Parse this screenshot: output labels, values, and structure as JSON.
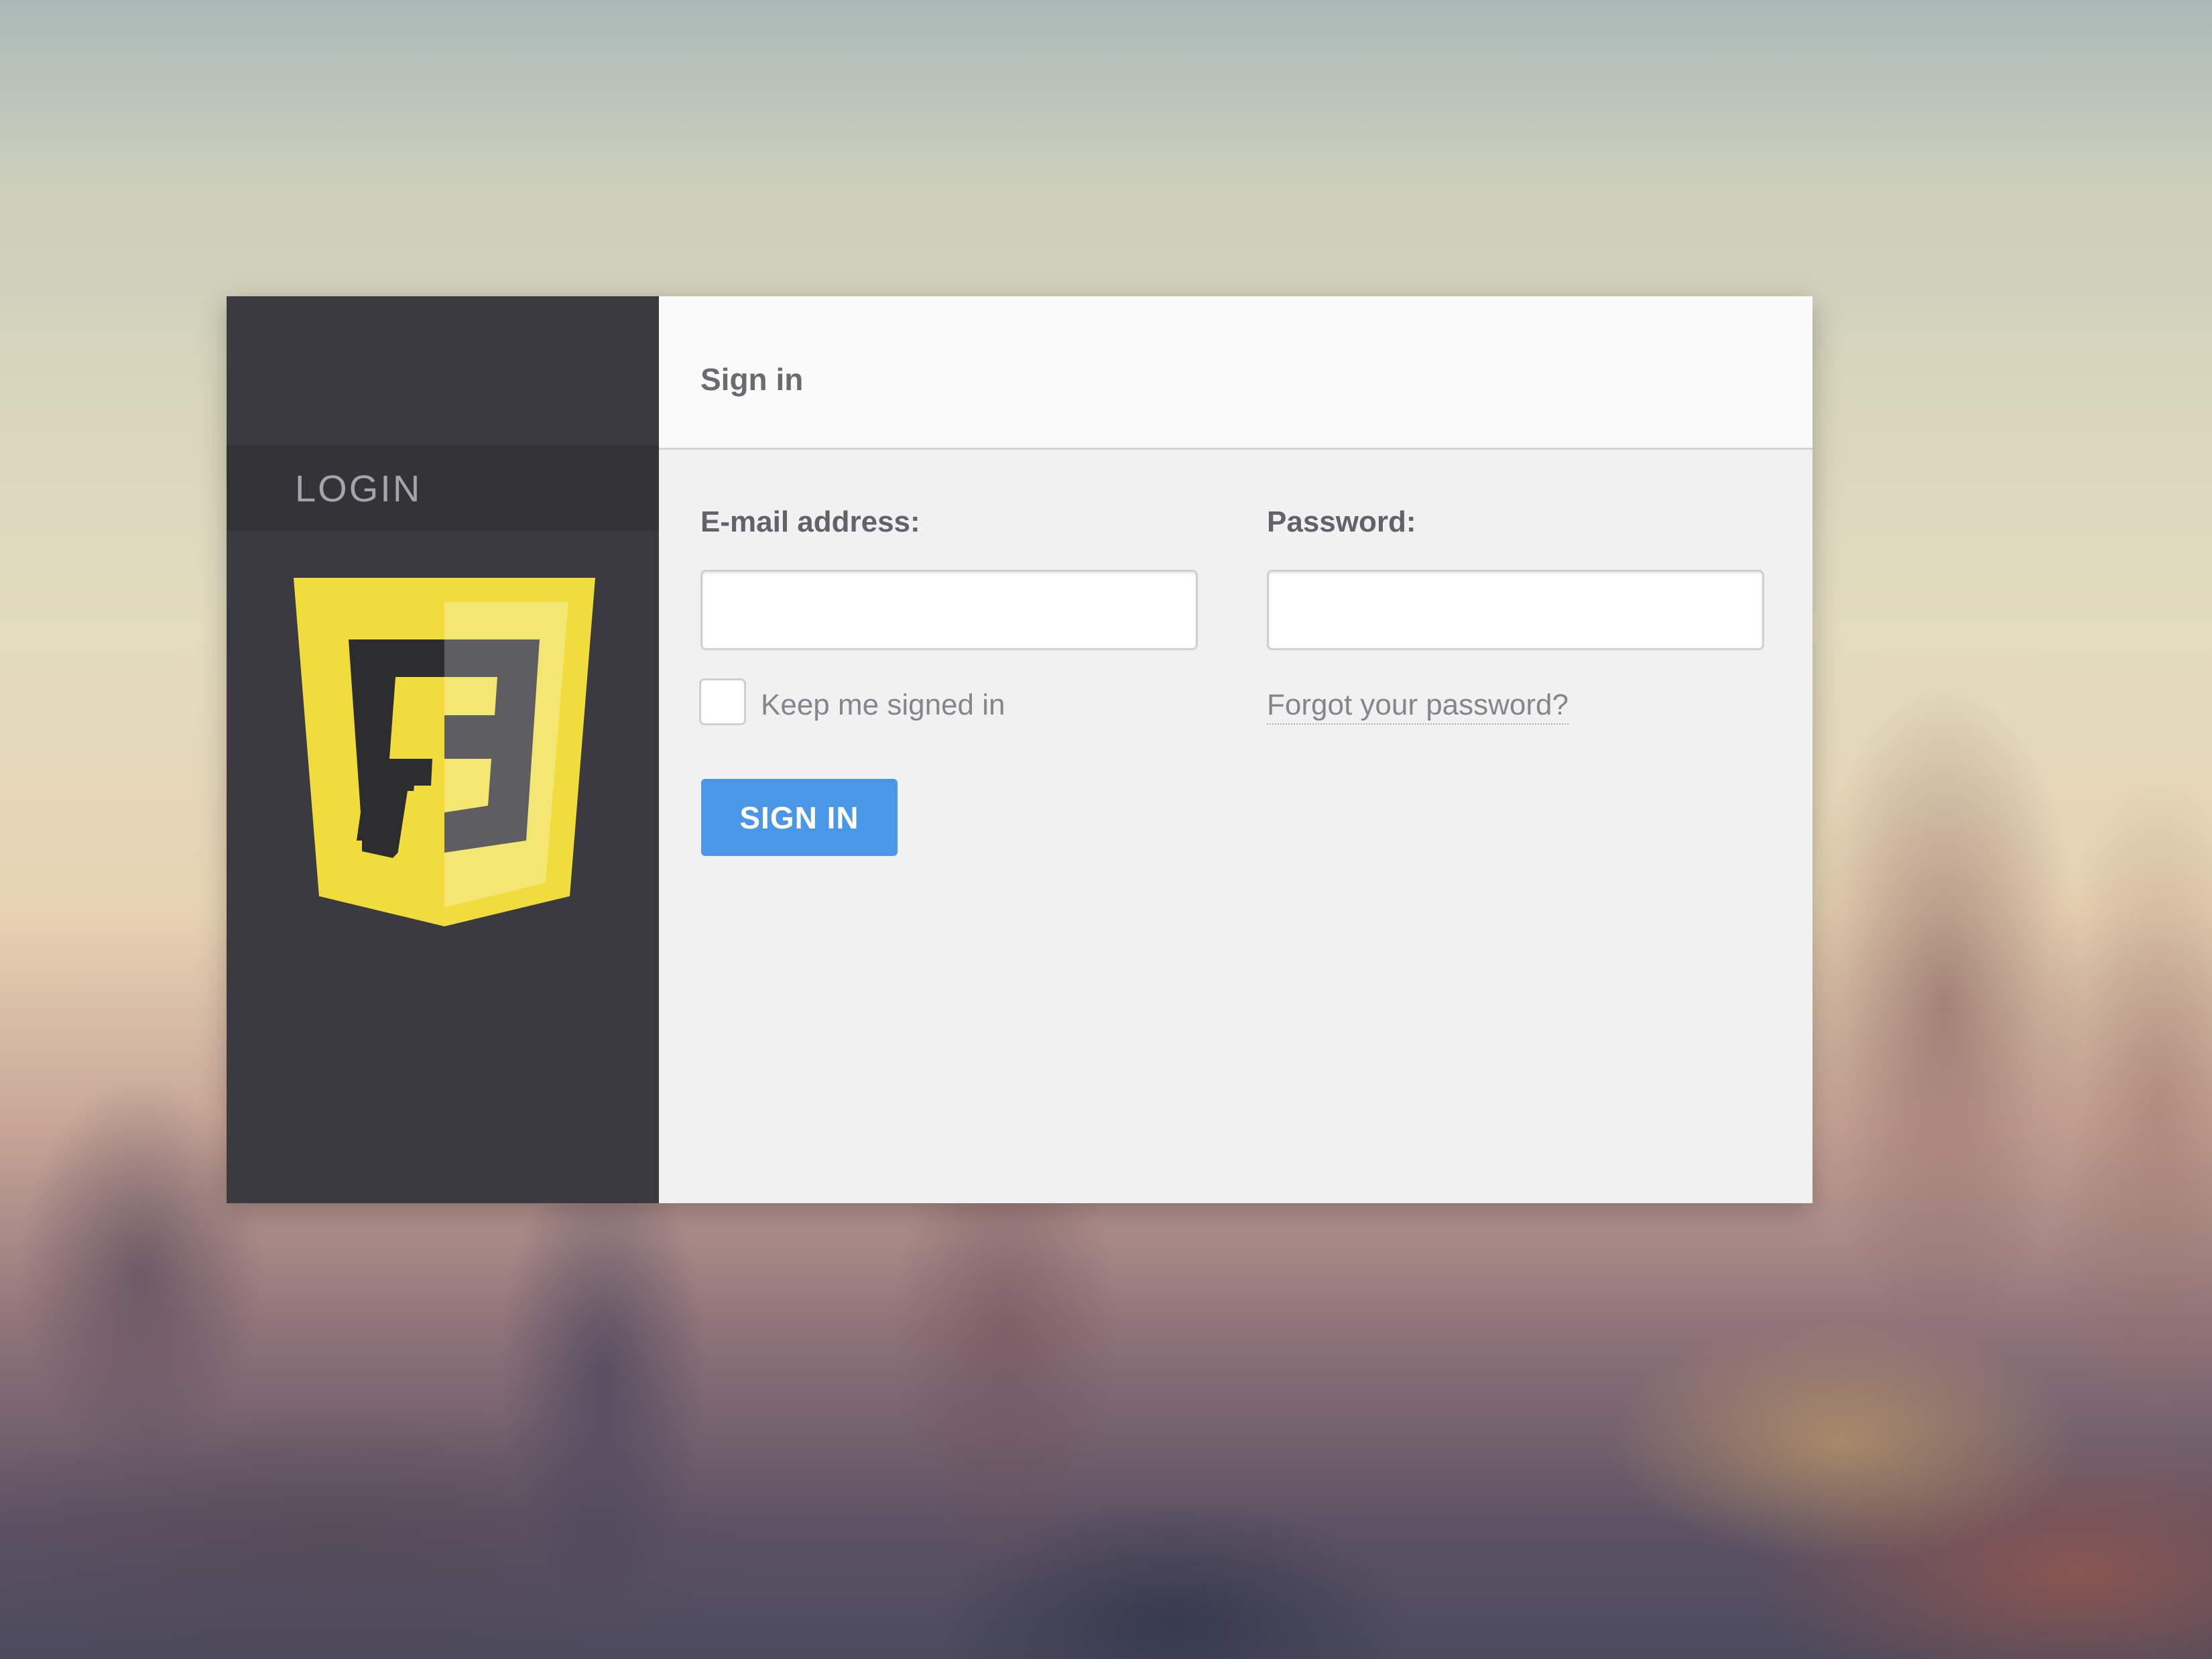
{
  "sidebar": {
    "tab_label": "LOGIN",
    "logo": {
      "icon": "shield-f3-logo-icon",
      "colors": {
        "yellow": "#f0dc3c",
        "light_yellow": "#f4e673",
        "dark": "#2d2d30",
        "gray": "#5e5e62"
      }
    }
  },
  "form": {
    "title": "Sign in",
    "email_label": "E-mail address:",
    "email_value": "",
    "password_label": "Password:",
    "password_value": "",
    "remember_label": "Keep me signed in",
    "forgot_link": "Forgot your password?",
    "submit_label": "SIGN IN"
  },
  "colors": {
    "sidebar_bg": "#3a3a40",
    "button_bg": "#4a97e8",
    "panel_bg": "#f1f1f1"
  }
}
